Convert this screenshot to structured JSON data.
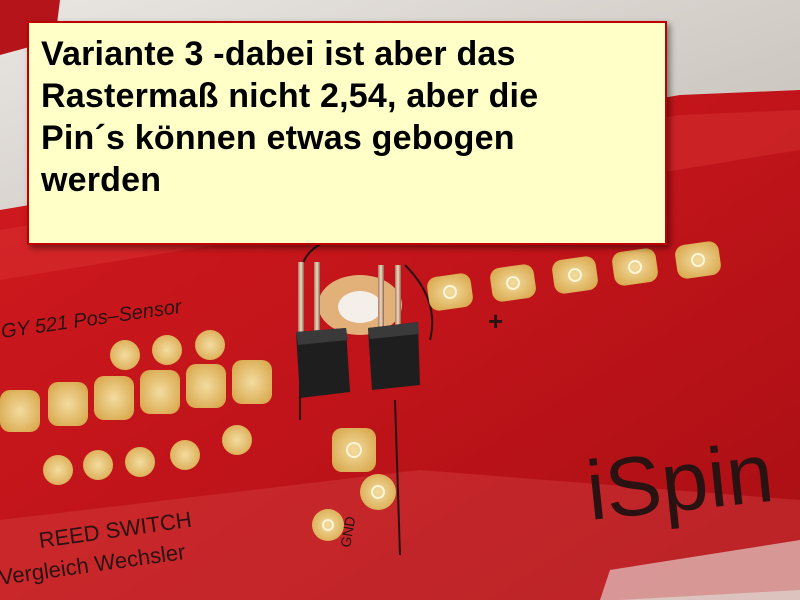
{
  "caption": {
    "text": "Variante 3 -dabei ist aber das\nRastermaß nicht 2,54, aber die\nPin´s können etwas gebogen\nwerden"
  },
  "pcb_labels": {
    "sensor_label": "GY 521 Pos-Sensor",
    "reed_label": "REED SWITCH",
    "wechsler_label": "Vergleich Wechsler",
    "brand_label": "iSpin",
    "plus_sign": "+",
    "gnd_label": "GND"
  },
  "colors": {
    "pcb_red": "#c8141a",
    "pad_gold": "#e8c46a",
    "caption_bg": "#ffffc8",
    "caption_border": "#c00000"
  }
}
